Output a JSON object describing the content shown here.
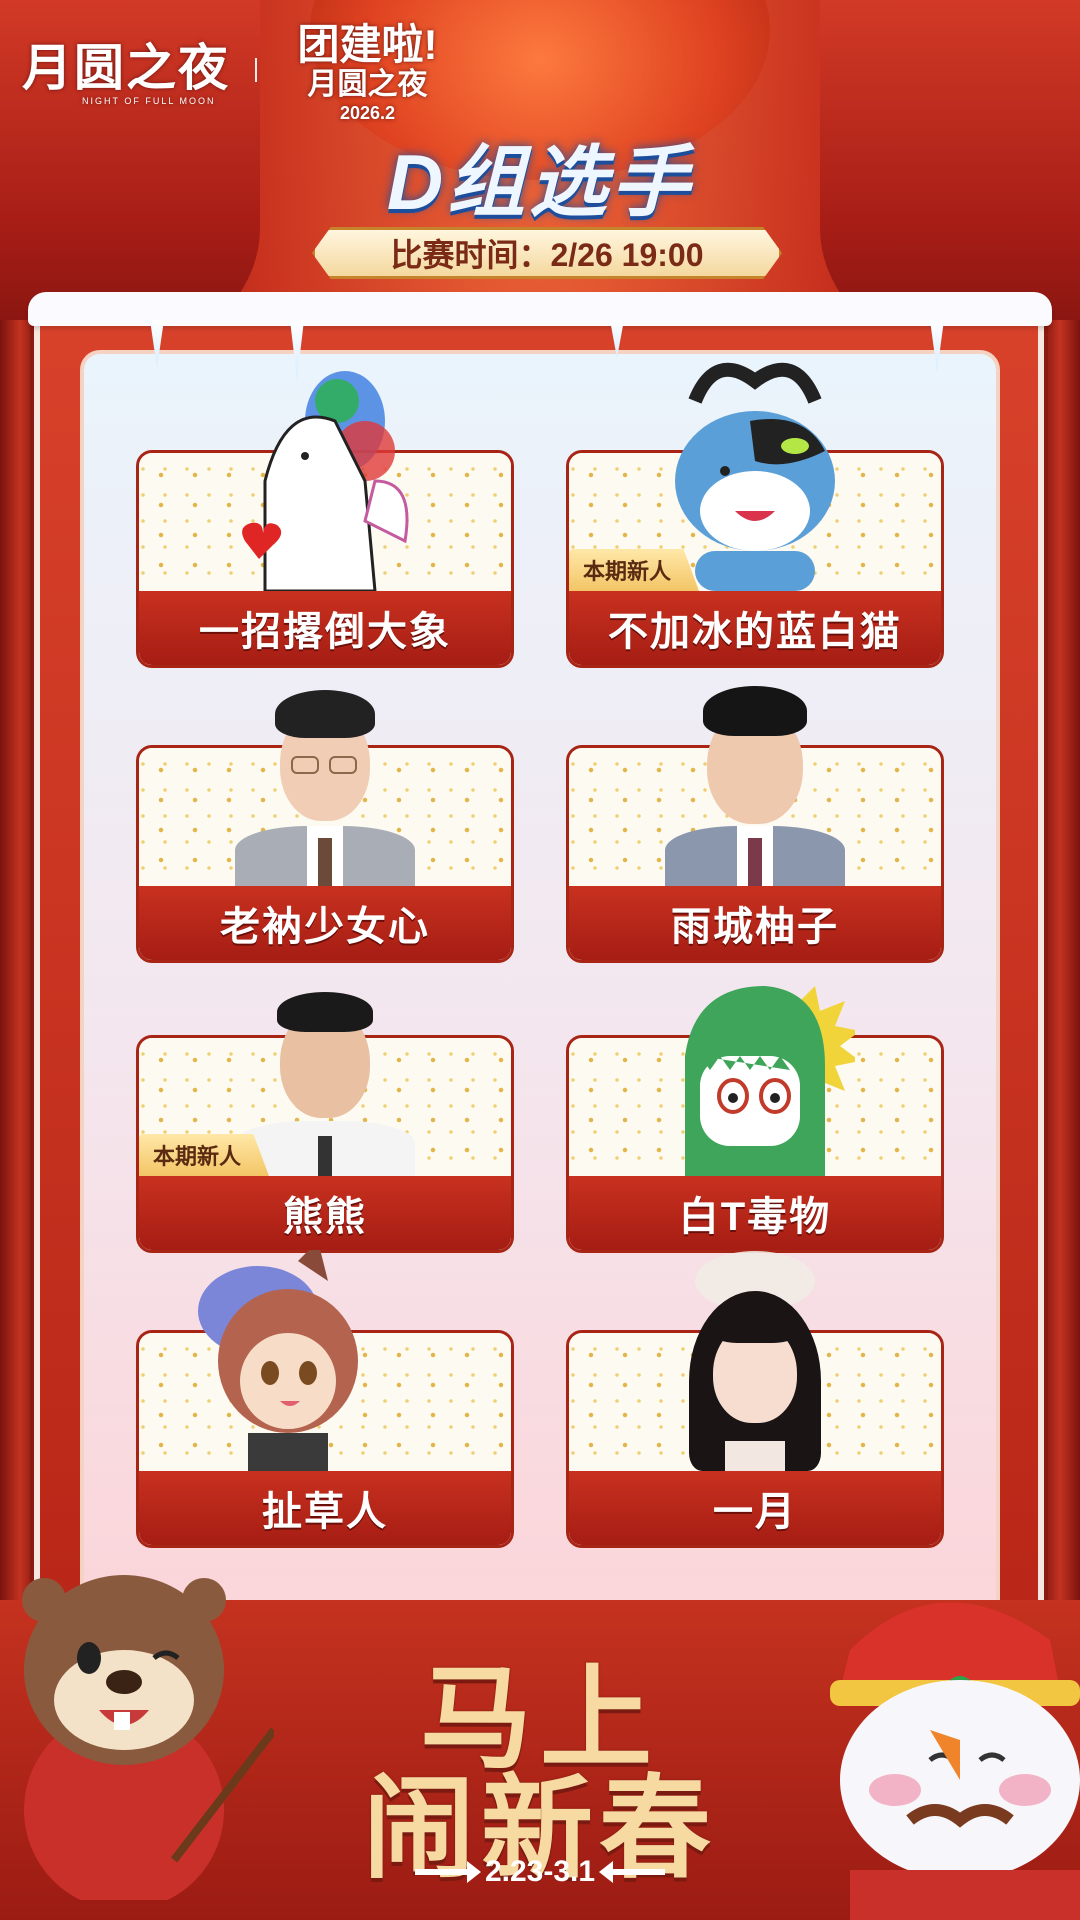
{
  "header": {
    "logo_text": "月圆之夜",
    "logo_subtext": "NIGHT OF FULL MOON",
    "event_line1": "团建啦!",
    "event_line2": "月圆之夜",
    "event_line3": "2026.2",
    "group_title": "D组选手",
    "match_time": "比赛时间：2/26 19:00"
  },
  "players": [
    {
      "name": "一招撂倒大象",
      "new": ""
    },
    {
      "name": "不加冰的蓝白猫",
      "new": "本期新人"
    },
    {
      "name": "老衲少女心",
      "new": ""
    },
    {
      "name": "雨城柚子",
      "new": ""
    },
    {
      "name": "熊熊",
      "new": "本期新人"
    },
    {
      "name": "白T毒物",
      "new": ""
    },
    {
      "name": "扯草人",
      "new": ""
    },
    {
      "name": "一月",
      "new": ""
    }
  ],
  "footer": {
    "slogan_line1": "马上",
    "slogan_line2": "闹新春",
    "dates": "2.23-3.1"
  },
  "colors": {
    "accent_red": "#b92617",
    "gold": "#f7d9a2",
    "title_blue": "#1d4e9c"
  }
}
